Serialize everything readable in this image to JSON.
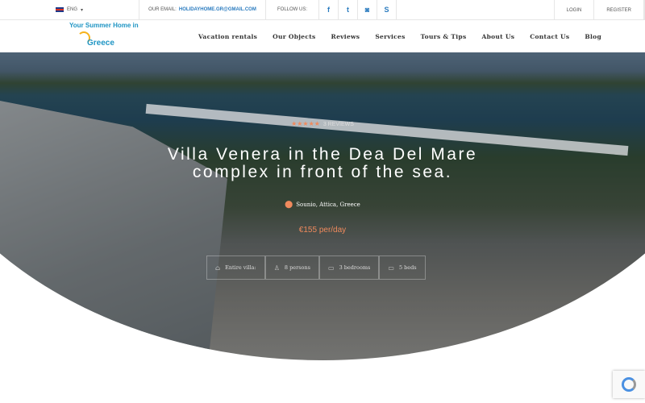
{
  "topbar": {
    "lang": "ENG",
    "email_label": "OUR EMAIL:",
    "email": "HOLIDAYHOME.GR@GMAIL.COM",
    "follow": "FOLLOW US:",
    "login": "LOGIN",
    "register": "REGISTER"
  },
  "logo": {
    "line1": "Your Summer Home in",
    "line2": "Greece"
  },
  "menu": [
    "Vacation rentals",
    "Our Objects",
    "Reviews",
    "Services",
    "Tours & Tips",
    "About Us",
    "Contact Us",
    "Blog"
  ],
  "hero": {
    "stars": "★★★★★",
    "reviews": "3 REVIEWS",
    "title_line1": "Villa Venera in the Dea Del Mare",
    "title_line2": "complex in front of the sea.",
    "location": "Sounio, Attica, Greece",
    "price": "€155 per/day",
    "features": [
      "Entire villa:",
      "8 persons",
      "3 bedrooms",
      "5 beds"
    ]
  },
  "colors": {
    "accent": "#f08a5d",
    "brand": "#1f95c4"
  }
}
